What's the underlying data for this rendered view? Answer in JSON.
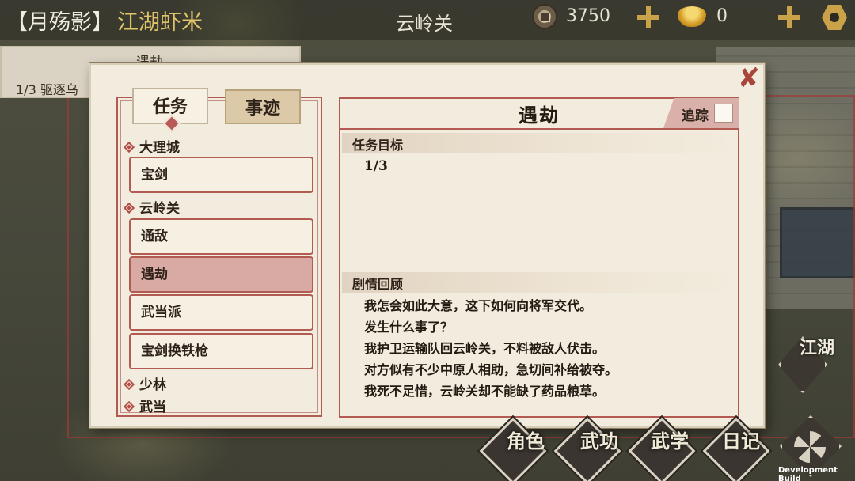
{
  "header": {
    "player_name": "【月殇影】",
    "player_title": "江湖虾米",
    "location": "云岭关",
    "coins": "3750",
    "ingots": "0"
  },
  "tracker": {
    "title": "遇劫",
    "row": "1/3 驱逐乌"
  },
  "dialog": {
    "tabs": [
      "任务",
      "事迹"
    ],
    "categories": [
      {
        "label": "大理城",
        "items": [
          "宝剑"
        ]
      },
      {
        "label": "云岭关",
        "items": [
          "通敌",
          "遇劫",
          "武当派",
          "宝剑换铁枪"
        ]
      },
      {
        "label": "少林",
        "items": []
      },
      {
        "label": "武当",
        "items": []
      }
    ],
    "selected_item": "遇劫",
    "detail": {
      "title": "遇劫",
      "track_label": "追踪",
      "objective_header": "任务目标",
      "progress": "1/3",
      "story_header": "剧情回顾",
      "story_lines": [
        "我怎会如此大意，这下如何向将军交代。",
        "发生什么事了？",
        "我护卫运输队回云岭关，不料被敌人伏击。",
        "对方似有不少中原人相助，急切间补给被夺。",
        "我死不足惜，云岭关却不能缺了药品粮草。"
      ]
    }
  },
  "menu": {
    "jianghu": "江湖",
    "items": [
      "角色",
      "武功",
      "武学",
      "日记"
    ]
  },
  "dev_build": "Development Build",
  "colors": {
    "accent_red": "#b35a52",
    "gold": "#c9a24a",
    "paper": "#f2ecde"
  }
}
